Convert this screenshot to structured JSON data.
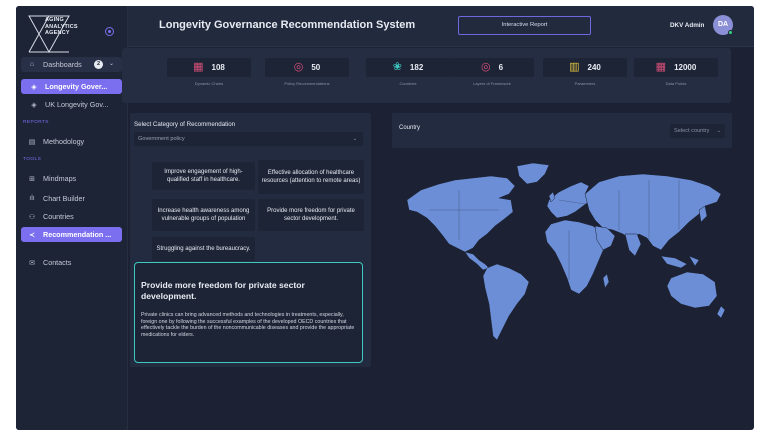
{
  "app": {
    "logo_lines": [
      "AGING",
      "ANALYTICS",
      "AGENCY"
    ],
    "title": "Longevity Governance Recommendation System",
    "interactive_report_label": "Interactive Report",
    "user_name": "DKV Admin",
    "avatar_initials": "DA",
    "accent_color": "#7b6ff0",
    "stat_icon_color": "#d84f7a",
    "highlight_border_color": "#3ec9c1"
  },
  "sidebar": {
    "dashboards": {
      "label": "Dashboards",
      "badge": "2",
      "icon": "home-icon"
    },
    "sub_items": [
      {
        "label": "Longevity Gover...",
        "icon": "cube-icon"
      },
      {
        "label": "UK Longevity Gov...",
        "icon": "cube-icon"
      }
    ],
    "reports_section": "REPORTS",
    "reports": [
      {
        "label": "Methodology",
        "icon": "document-icon"
      }
    ],
    "tools_section": "TOOLS",
    "tools": [
      {
        "label": "Mindmaps",
        "icon": "grid-icon"
      },
      {
        "label": "Chart Builder",
        "icon": "bar-chart-icon"
      },
      {
        "label": "Countries",
        "icon": "users-icon"
      },
      {
        "label": "Recommendation ...",
        "icon": "share-icon"
      }
    ],
    "contacts": {
      "label": "Contacts",
      "icon": "mail-icon"
    }
  },
  "stats": [
    {
      "value": "108",
      "label": "Dynamic Charts",
      "icon": "grid-icon"
    },
    {
      "value": "50",
      "label": "Policy Recommendations",
      "icon": "compass-icon"
    },
    {
      "value": "182",
      "label": "Countries",
      "icon": "globe-icon"
    },
    {
      "value": "6",
      "label": "Layers of Framework",
      "icon": "compass-icon"
    },
    {
      "value": "240",
      "label": "Parameters",
      "icon": "building-icon"
    },
    {
      "value": "12000",
      "label": "Data Points",
      "icon": "grid-icon"
    }
  ],
  "recommendation": {
    "category_label": "Select Category of Recommendation",
    "category_value": "Government policy",
    "cards": [
      "Improve engagement of high-qualified staff in healthcare.",
      "Effective allocation of healthcare resources (attention to remote areas)",
      "Increase health awareness among vulnerable groups of population",
      "Provide more freedom for private sector development.",
      "Struggling against the bureaucracy."
    ],
    "detail_title": "Provide more freedom for private sector development.",
    "detail_body": "Private clinics can bring advanced methods and technologies in treatments, especially, foreign one by following the successful examples of the developed OECD countries that effectively tackle the burden of the noncommunicable diseases and provide the appropriate medications for elders."
  },
  "country": {
    "label": "Country",
    "select_placeholder": "Select country",
    "map_color": "#6b8ed6"
  }
}
